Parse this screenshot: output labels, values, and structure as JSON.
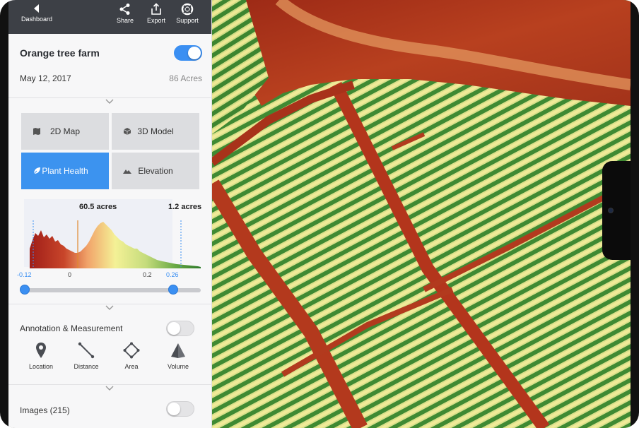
{
  "topbar": {
    "back_label": "Dashboard",
    "share_label": "Share",
    "export_label": "Export",
    "support_label": "Support"
  },
  "project": {
    "name": "Orange tree farm",
    "visible": true,
    "date": "May 12, 2017",
    "area": "86 Acres"
  },
  "views": {
    "map2d": "2D Map",
    "model3d": "3D Model",
    "plant_health": "Plant Health",
    "elevation": "Elevation",
    "active": "Plant Health"
  },
  "histogram": {
    "left_area": "60.5 acres",
    "right_area": "1.2 acres",
    "tick_min": "-0.12",
    "tick_zero": "0",
    "tick_02": "0.2",
    "tick_max": "0.26",
    "range_min": -0.12,
    "range_max": 0.26
  },
  "annotation": {
    "title": "Annotation & Measurement",
    "enabled": false,
    "tools": {
      "location": "Location",
      "distance": "Distance",
      "area": "Area",
      "volume": "Volume"
    }
  },
  "images": {
    "title": "Images (215)",
    "enabled": false
  },
  "colors": {
    "accent": "#3b8ff2",
    "topbar": "#3d4046",
    "health_low": "#a8251b",
    "health_mid": "#f2f0a0",
    "health_high": "#2f7a2a"
  }
}
